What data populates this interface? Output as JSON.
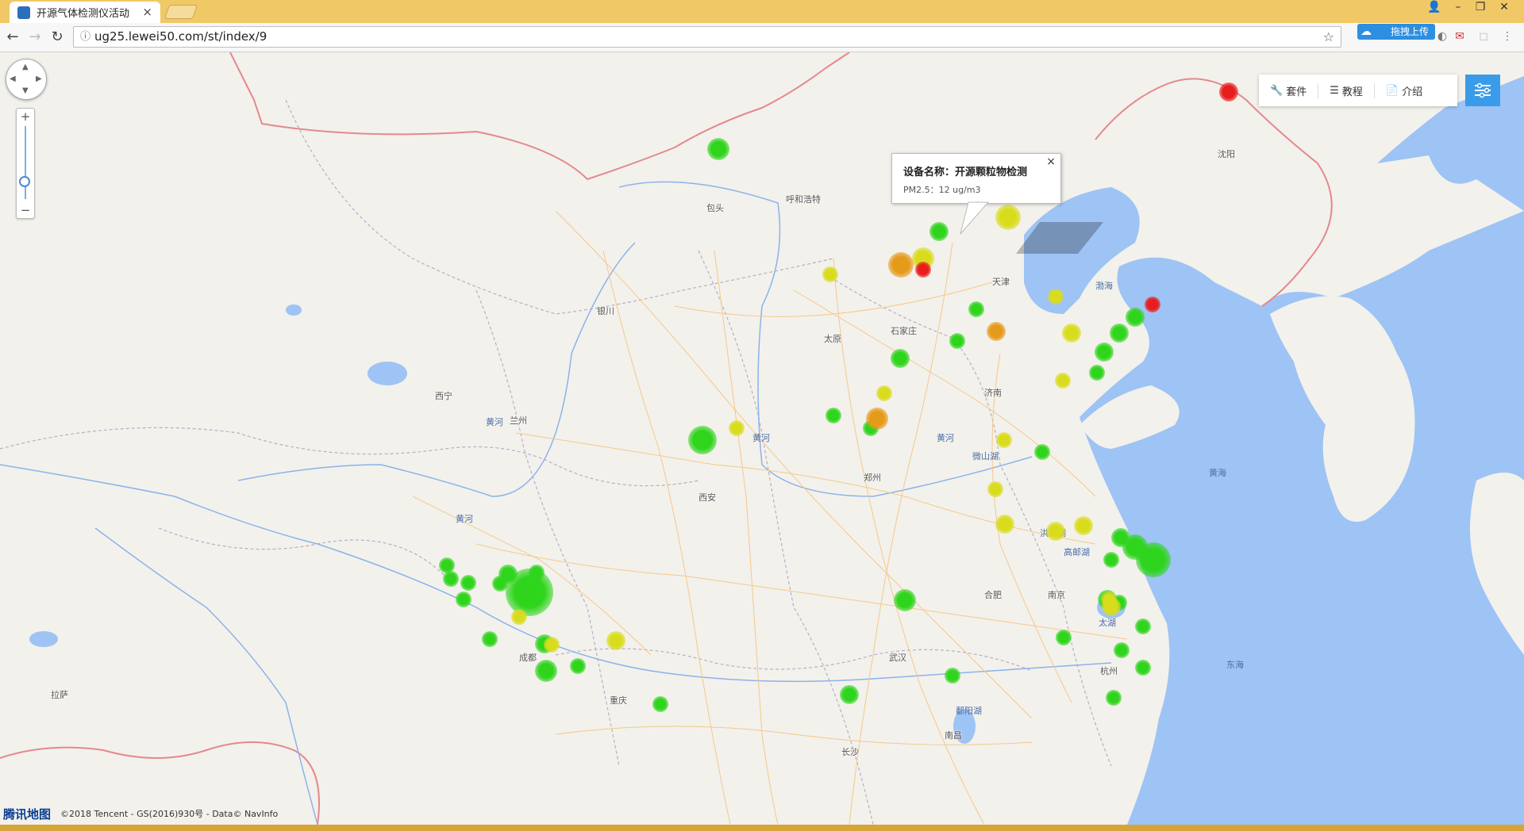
{
  "browser": {
    "tab_title": "开源气体检测仪活动",
    "tab_close": "×",
    "url": "ug25.lewei50.com/st/index/9",
    "ext_label": "拖拽上传"
  },
  "map": {
    "cities": [
      {
        "name": "呼和浩特"
      },
      {
        "name": "银川"
      },
      {
        "name": "太原"
      },
      {
        "name": "石家庄"
      },
      {
        "name": "天津"
      },
      {
        "name": "西宁"
      },
      {
        "name": "兰州"
      },
      {
        "name": "济南"
      },
      {
        "name": "郑州"
      },
      {
        "name": "合肥"
      },
      {
        "name": "南京"
      },
      {
        "name": "杭州"
      },
      {
        "name": "武汉"
      },
      {
        "name": "长沙"
      },
      {
        "name": "南昌"
      },
      {
        "name": "重庆"
      },
      {
        "name": "拉萨"
      },
      {
        "name": "沈阳"
      },
      {
        "name": "包头"
      },
      {
        "name": "西安"
      },
      {
        "name": "成都"
      }
    ],
    "water": [
      {
        "name": "渤海"
      },
      {
        "name": "黄海"
      },
      {
        "name": "东海"
      },
      {
        "name": "黄河"
      },
      {
        "name": "黄河"
      },
      {
        "name": "黄河"
      },
      {
        "name": "黄河"
      },
      {
        "name": "微山湖"
      },
      {
        "name": "洪泽湖"
      },
      {
        "name": "高邮湖"
      },
      {
        "name": "太湖"
      },
      {
        "name": "鄱阳湖"
      }
    ],
    "sensors": [
      {
        "level": "green"
      },
      {
        "level": "green"
      },
      {
        "level": "green"
      },
      {
        "level": "yellow"
      },
      {
        "level": "red"
      },
      {
        "level": "yellow"
      },
      {
        "level": "green"
      },
      {
        "level": "orange"
      },
      {
        "level": "red"
      },
      {
        "level": "yellow"
      },
      {
        "level": "yellow"
      },
      {
        "level": "green"
      },
      {
        "level": "green"
      },
      {
        "level": "orange"
      },
      {
        "level": "green"
      },
      {
        "level": "yellow"
      },
      {
        "level": "yellow"
      },
      {
        "level": "green"
      },
      {
        "level": "green"
      },
      {
        "level": "red"
      },
      {
        "level": "green"
      },
      {
        "level": "green"
      },
      {
        "level": "yellow"
      },
      {
        "level": "green"
      },
      {
        "level": "green"
      },
      {
        "level": "yellow"
      },
      {
        "level": "orange"
      },
      {
        "level": "green"
      },
      {
        "level": "yellow"
      },
      {
        "level": "yellow"
      },
      {
        "level": "green"
      },
      {
        "level": "yellow"
      },
      {
        "level": "yellow"
      },
      {
        "level": "yellow"
      },
      {
        "level": "green"
      },
      {
        "level": "green"
      },
      {
        "level": "green"
      },
      {
        "level": "green"
      },
      {
        "level": "green"
      },
      {
        "level": "green"
      },
      {
        "level": "green"
      },
      {
        "level": "yellow"
      },
      {
        "level": "yellow"
      },
      {
        "level": "green"
      },
      {
        "level": "green"
      },
      {
        "level": "green"
      },
      {
        "level": "green"
      },
      {
        "level": "green"
      },
      {
        "level": "green"
      },
      {
        "level": "green"
      },
      {
        "level": "yellow"
      },
      {
        "level": "green"
      },
      {
        "level": "green"
      },
      {
        "level": "green"
      },
      {
        "level": "green"
      },
      {
        "level": "green"
      },
      {
        "level": "green"
      },
      {
        "level": "green"
      },
      {
        "level": "green"
      },
      {
        "level": "green"
      },
      {
        "level": "green"
      },
      {
        "level": "green"
      },
      {
        "level": "green"
      },
      {
        "level": "green"
      },
      {
        "level": "yellow"
      },
      {
        "level": "yellow"
      }
    ],
    "colors": {
      "green": "#2fd41c",
      "yellow": "#d9dc1c",
      "orange": "#e59a1a",
      "red": "#e81d1d",
      "sea": "#9ec3f5"
    }
  },
  "menu": {
    "kit": "套件",
    "tutorial": "教程",
    "intro": "介绍"
  },
  "popup": {
    "title": "设备名称：开源颗粒物检测",
    "value": "PM2.5：12 ug/m3",
    "close": "×"
  },
  "attribution": {
    "logo": "腾讯地图",
    "text": "©2018 Tencent - GS(2016)930号 - Data© NavInfo"
  }
}
